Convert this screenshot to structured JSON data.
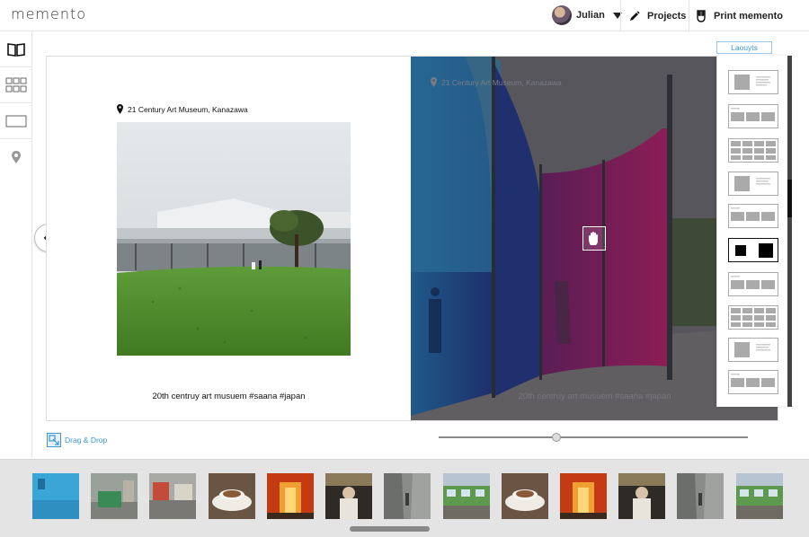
{
  "app": {
    "logo": "memento"
  },
  "header": {
    "user_name": "Julian",
    "projects_label": "Projects",
    "print_label": "Print memento"
  },
  "spread": {
    "left": {
      "location": "21 Century Art Museum, Kanazawa",
      "caption": "20th centruy art musuem #saana #japan"
    },
    "right": {
      "location": "21 Century Art Museum, Kanazawa",
      "caption": "20th centruy art musuem #saana #japan"
    }
  },
  "layouts": {
    "tab_label": "Laouyts",
    "items": [
      "photo-text",
      "three-row",
      "grid-8",
      "photo-text",
      "three-row",
      "two-squares",
      "three-row",
      "grid-8",
      "photo-text",
      "three-row"
    ],
    "selected_index": 5
  },
  "toolbar": {
    "drag_drop_label": "Drag & Drop"
  },
  "zoom": {
    "level": 0.37
  },
  "filmstrip": {
    "thumbnails": [
      "pool",
      "street-bus",
      "street-crowd",
      "coffee-cup",
      "torii-gates",
      "bar-portrait",
      "alley",
      "green-train",
      "coffee-cup",
      "torii-gates",
      "bar-portrait",
      "alley",
      "green-train"
    ]
  },
  "colors": {
    "accent": "#3c97d3"
  }
}
